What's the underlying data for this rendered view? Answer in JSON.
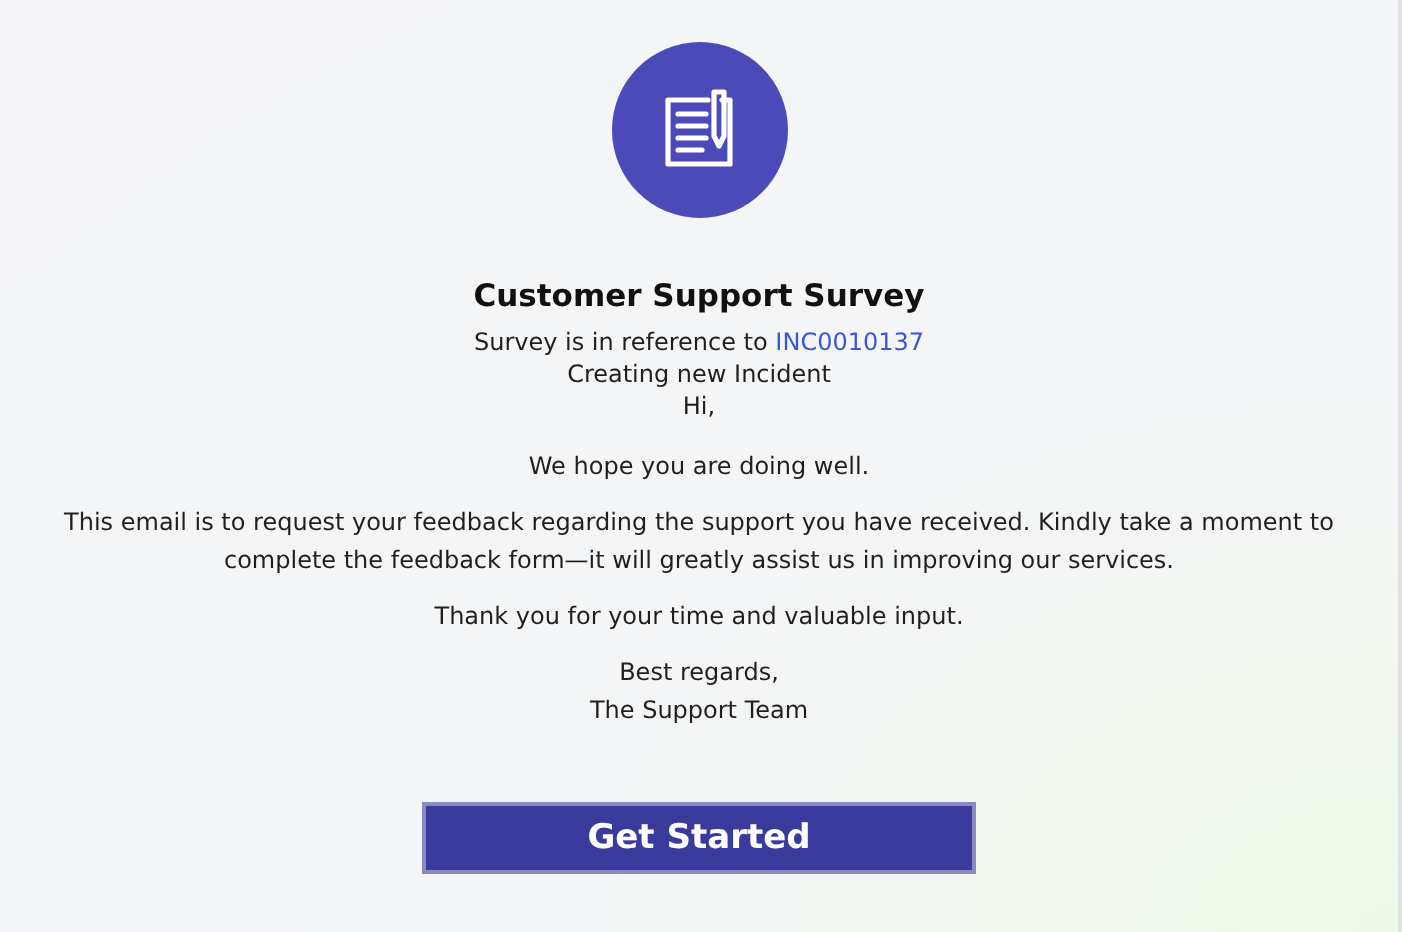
{
  "survey": {
    "title": "Customer Support Survey",
    "reference": {
      "text": "Survey is in reference to",
      "link": "INC0010137"
    },
    "subtitle": "Creating new Incident",
    "greeting": "Hi,",
    "paragraphs": [
      "We hope you are doing well.",
      "This email is to request your feedback regarding the support you have received. Kindly take a moment to complete the feedback form—it will greatly assist us in improving our services.",
      "Thank you for your time and valuable input."
    ],
    "signoff": [
      "Best regards,",
      "The Support Team"
    ],
    "button": "Get Started"
  }
}
